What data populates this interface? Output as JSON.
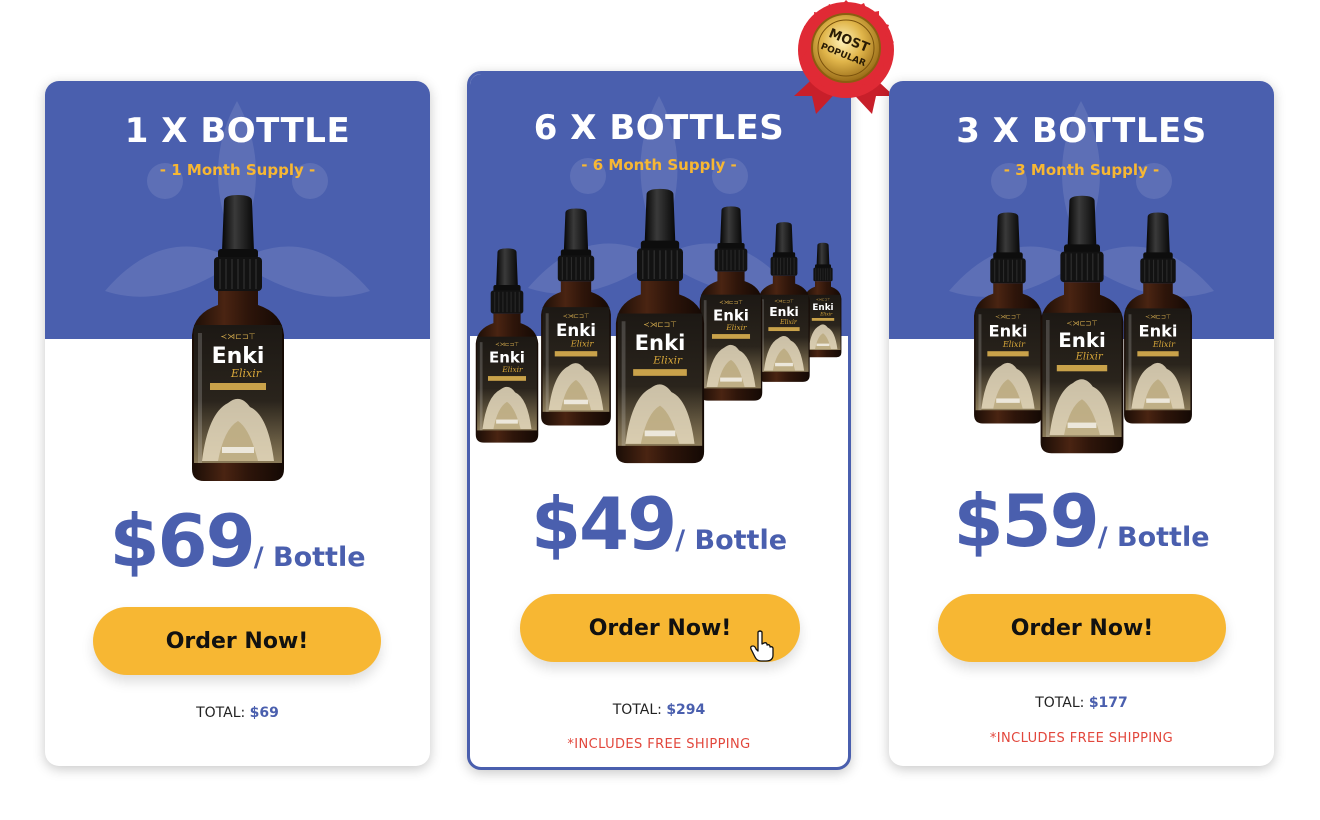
{
  "colors": {
    "accent_blue": "#4a5fae",
    "button_yellow": "#f7b733",
    "shipping_red": "#e2473c",
    "badge_red": "#e02a35",
    "badge_gold": "#d4a73b"
  },
  "badge": {
    "line1": "MOST",
    "line2": "POPULAR",
    "icon": "most-popular-ribbon-icon"
  },
  "cards": [
    {
      "title": "1 X BOTTLE",
      "supply": "- 1 Month Supply -",
      "price": "$69",
      "price_unit": "/ Bottle",
      "button_label": "Order Now!",
      "total_label": "TOTAL:",
      "total_value": "$69",
      "shipping": ""
    },
    {
      "title": "6 X BOTTLES",
      "supply": "- 6 Month Supply -",
      "price": "$49",
      "price_unit": "/ Bottle",
      "button_label": "Order Now!",
      "total_label": "TOTAL:",
      "total_value": "$294",
      "shipping": "*INCLUDES FREE SHIPPING"
    },
    {
      "title": "3 X BOTTLES",
      "supply": "- 3 Month Supply -",
      "price": "$59",
      "price_unit": "/ Bottle",
      "button_label": "Order Now!",
      "total_label": "TOTAL:",
      "total_value": "$177",
      "shipping": "*INCLUDES FREE SHIPPING"
    }
  ],
  "product_label": {
    "brand": "Enki",
    "sub": "Elixir"
  }
}
